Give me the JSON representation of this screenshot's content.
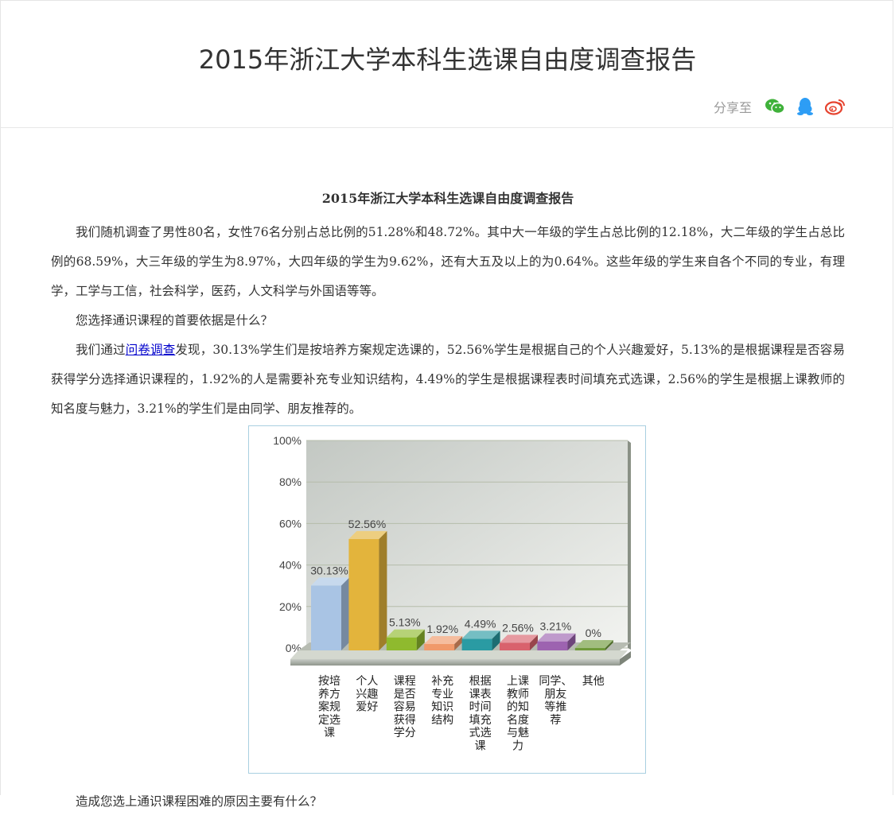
{
  "header": {
    "title": "2015年浙江大学本科生选课自由度调查报告",
    "share_label": "分享至",
    "share_icons": [
      "wechat-icon",
      "qq-icon",
      "weibo-icon"
    ]
  },
  "article": {
    "title": "2015年浙江大学本科生选课自由度调查报告",
    "p1": "我们随机调查了男性80名，女性76名分别占总比例的51.28%和48.72%。其中大一年级的学生占总比例的12.18%，大二年级的学生占总比例的68.59%，大三年级的学生为8.97%，大四年级的学生为9.62%，还有大五及以上的为0.64%。这些年级的学生来自各个不同的专业，有理学，工学与工信，社会科学，医药，人文科学与外国语等等。",
    "p2": "您选择通识课程的首要依据是什么？",
    "p3_prefix": "我们通过",
    "p3_link": "问卷调查",
    "p3_suffix": "发现，30.13%学生们是按培养方案规定选课的，52.56%学生是根据自己的个人兴趣爱好，5.13%的是根据课程是否容易获得学分选择通识课程的，1.92%的人是需要补充专业知识结构，4.49%的学生是根据课程表时间填充式选课，2.56%的学生是根据上课教师的知名度与魅力，3.21%的学生们是由同学、朋友推荐的。",
    "p4": "造成您选上通识课程困难的原因主要有什么？"
  },
  "chart_data": {
    "type": "bar",
    "categories": [
      "按培养方案规定选课",
      "个人兴趣爱好",
      "课程是否容易获得学分",
      "补充专业知识结构",
      "根据课表时间填充式选课",
      "上课教师的知名度与魅力",
      "同学、朋友等推荐",
      "其他"
    ],
    "category_lines": [
      [
        "按培",
        "养方",
        "案规",
        "定选",
        "课"
      ],
      [
        "个人",
        "兴趣",
        "爱好"
      ],
      [
        "课程",
        "是否",
        "容易",
        "获得",
        "学分"
      ],
      [
        "补充",
        "专业",
        "知识",
        "结构"
      ],
      [
        "根据",
        "课表",
        "时间",
        "填充",
        "式选",
        "课"
      ],
      [
        "上课",
        "教师",
        "的知",
        "名度",
        "与魅",
        "力"
      ],
      [
        "同学、",
        "朋友",
        "等推",
        "荐"
      ],
      [
        "其他"
      ]
    ],
    "values": [
      30.13,
      52.56,
      5.13,
      1.92,
      4.49,
      2.56,
      3.21,
      0
    ],
    "value_labels": [
      "30.13%",
      "52.56%",
      "5.13%",
      "1.92%",
      "4.49%",
      "2.56%",
      "3.21%",
      "0%"
    ],
    "y_ticks": [
      "0%",
      "20%",
      "40%",
      "60%",
      "80%",
      "100%"
    ],
    "ylim": [
      0,
      100
    ],
    "colors": [
      "#a9c4e4",
      "#e3b43c",
      "#8fba2e",
      "#f0996a",
      "#2a9ba3",
      "#d9626d",
      "#9d63b0",
      "#6f9a3a"
    ],
    "grid": true
  }
}
